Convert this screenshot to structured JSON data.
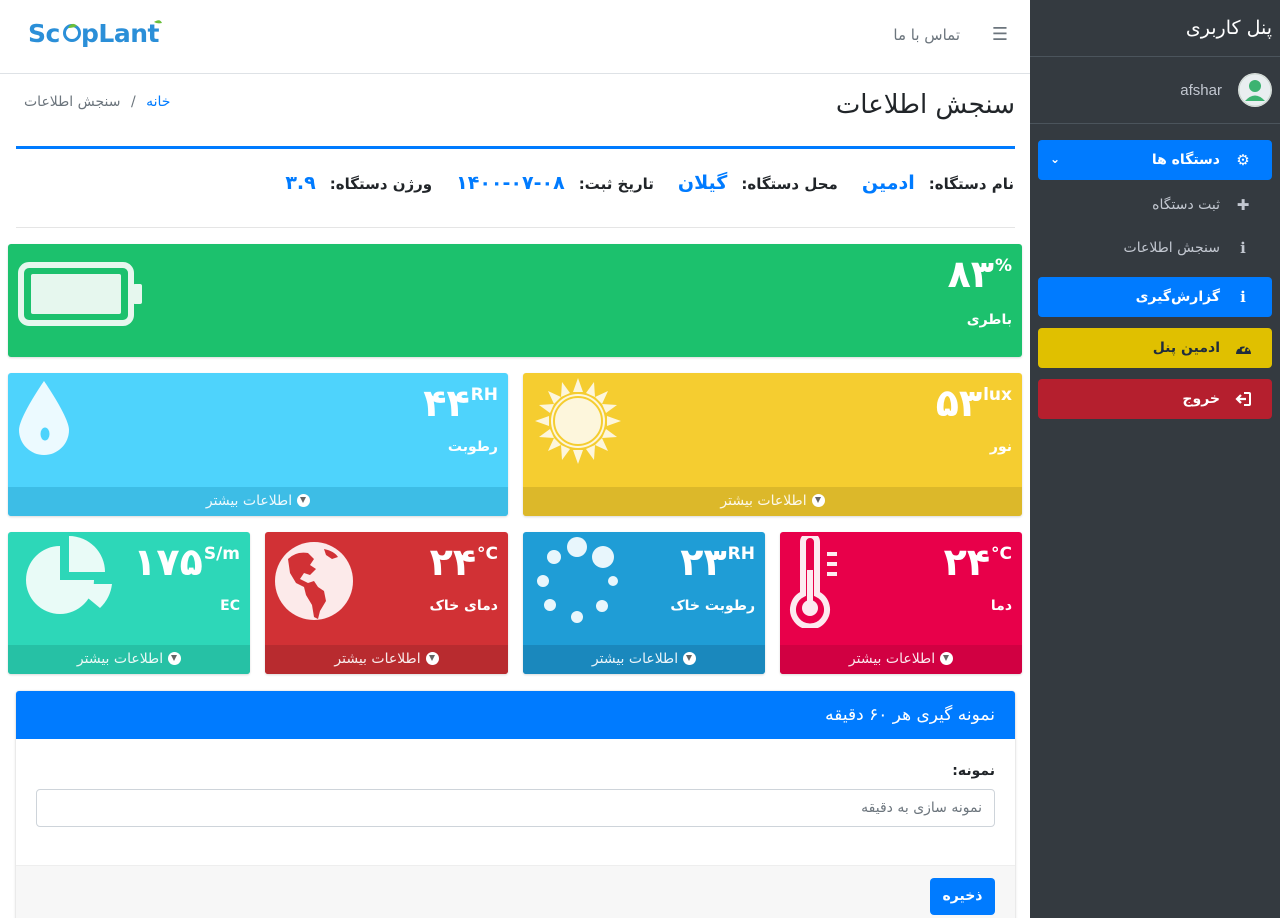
{
  "header": {
    "logo_text": "Scoplant",
    "contact_label": "تماس با ما"
  },
  "sidebar": {
    "title": "پنل کاربری",
    "username": "afshar",
    "devices_label": "دستگاه ها",
    "register_device": "ثبت دستگاه",
    "measure": "سنجش اطلاعات",
    "reports": "گزارش‌گیری",
    "admin_panel": "ادمین پنل",
    "logout": "خروج"
  },
  "page": {
    "title": "سنجش اطلاعات",
    "breadcrumb_home": "خانه",
    "breadcrumb_sep": "/",
    "breadcrumb_current": "سنجش اطلاعات"
  },
  "device": {
    "name_label": "نام دستگاه:",
    "name": "ادمین",
    "location_label": "محل دستگاه:",
    "location": "گیلان",
    "date_label": "تاریخ ثبت:",
    "date": "۱۴۰۰-۰۷-۰۸",
    "version_label": "ورژن دستگاه:",
    "version": "۳.۹"
  },
  "boxes": {
    "battery": {
      "value": "۸۳",
      "unit": "%",
      "label": "باطری",
      "color": "#1cc16d"
    },
    "light": {
      "value": "۵۳",
      "unit": "lux",
      "label": "نور",
      "color": "#f5cd30",
      "more": "اطلاعات بیشتر"
    },
    "humidity": {
      "value": "۴۴",
      "unit": "RH",
      "label": "رطوبت",
      "color": "#4ed3fc",
      "more": "اطلاعات بیشتر"
    },
    "temp": {
      "value": "۲۴",
      "unit": "°C",
      "label": "دما",
      "color": "#e8004a",
      "more": "اطلاعات بیشتر"
    },
    "soil_humidity": {
      "value": "۲۳",
      "unit": "RH",
      "label": "رطوبت خاک",
      "color": "#1f9dd6",
      "more": "اطلاعات بیشتر"
    },
    "soil_temp": {
      "value": "۲۴",
      "unit": "°C",
      "label": "دمای خاک",
      "color": "#d13135",
      "more": "اطلاعات بیشتر"
    },
    "ec": {
      "value": "۱۷۵",
      "unit": "S/m",
      "label": "EC",
      "color": "#2dd7b8",
      "more": "اطلاعات بیشتر"
    }
  },
  "sampling": {
    "title": "نمونه گیری هر ۶۰ دقیقه",
    "field_label": "نمونه:",
    "field_value": "نمونه سازی به دقیقه",
    "save_label": "ذخیره"
  }
}
